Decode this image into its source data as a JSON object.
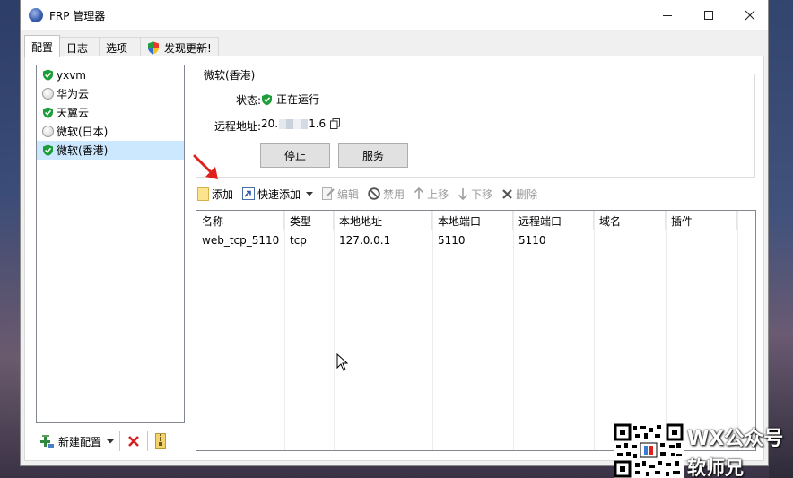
{
  "window": {
    "title": "FRP 管理器"
  },
  "tabs": [
    {
      "label": "配置",
      "active": true
    },
    {
      "label": "日志",
      "active": false
    },
    {
      "label": "选项",
      "active": false
    },
    {
      "label": "发现更新!",
      "active": false
    }
  ],
  "config_list": [
    {
      "name": "yxvm",
      "status": "running"
    },
    {
      "name": "华为云",
      "status": "stopped"
    },
    {
      "name": "天翼云",
      "status": "running"
    },
    {
      "name": "微软(日本)",
      "status": "stopped"
    },
    {
      "name": "微软(香港)",
      "status": "running",
      "selected": true
    }
  ],
  "bottom_bar": {
    "new_config_label": "新建配置"
  },
  "detail": {
    "group_title": "微软(香港)",
    "status_label": "状态:",
    "status_value": "正在运行",
    "remote_label": "远程地址:",
    "remote_value_prefix": "20.",
    "remote_value_suffix": "1.6",
    "stop_button": "停止",
    "service_button": "服务"
  },
  "toolbar": {
    "add": "添加",
    "quick_add": "快速添加",
    "edit": "编辑",
    "disable": "禁用",
    "move_up": "上移",
    "move_down": "下移",
    "delete": "删除"
  },
  "table": {
    "columns": [
      "名称",
      "类型",
      "本地地址",
      "本地端口",
      "远程端口",
      "域名",
      "插件"
    ],
    "rows": [
      [
        "web_tcp_5110",
        "tcp",
        "127.0.0.1",
        "5110",
        "5110",
        "",
        ""
      ]
    ]
  },
  "watermark": {
    "line1": "WX公众号",
    "line2": "软师兄"
  },
  "colors": {
    "selection": "#cce8ff",
    "running_green": "#1e9e3a",
    "annotation_red": "#e0201b"
  }
}
